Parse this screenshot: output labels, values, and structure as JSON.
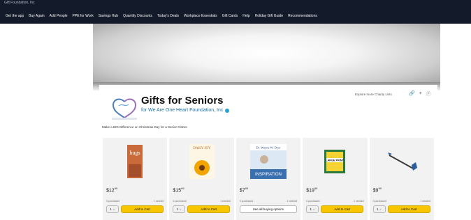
{
  "topbar": {
    "crumb": "Gift Foundation, Inc",
    "nav": [
      "Get the app",
      "Buy Again",
      "Add People",
      "PPE for Work",
      "Savings Hub",
      "Quantity Discounts",
      "Today's Deals",
      "Workplace Essentials",
      "Gift Cards",
      "Help",
      "Holiday Gift Guide",
      "Recommendations"
    ]
  },
  "list": {
    "title": "Gifts for Seniors",
    "subtitle": "for We Are One Heart Foundation, Inc",
    "explore": "Explore more Charity Lists",
    "description": "Make a BIG Difference on Christmas Day for a Senior Citizen"
  },
  "icons": {
    "link": "link-icon",
    "twitter": "twitter-icon",
    "pinterest": "pinterest-icon"
  },
  "products": [
    {
      "name": "hugs",
      "price_whole": "12",
      "price_frac": "99",
      "purchased": "0 purchased",
      "needed": "1 needed",
      "qty": "1",
      "action": "Add to Cart"
    },
    {
      "name": "Daily Joy",
      "price_whole": "15",
      "price_frac": "99",
      "purchased": "0 purchased",
      "needed": "1 needed",
      "qty": "1",
      "action": "Add to Cart"
    },
    {
      "name": "Inspiration",
      "price_whole": "7",
      "price_frac": "99",
      "purchased": "0 purchased",
      "needed": "1 needed",
      "qty": "",
      "action": "See all buying options"
    },
    {
      "name": "Large Print Cards",
      "price_whole": "19",
      "price_frac": "95",
      "purchased": "0 purchased",
      "needed": "1 needed",
      "qty": "1",
      "action": "Add to Cart"
    },
    {
      "name": "Reacher Grabber",
      "price_whole": "9",
      "price_frac": "99",
      "purchased": "0 purchased",
      "needed": "1 needed",
      "qty": "1",
      "action": "Add to Cart"
    }
  ],
  "book_covers": {
    "hugs": "hugs",
    "daily_joy": "DAILY JOY",
    "inspiration_author": "Dr. Wayne W. Dyer",
    "inspiration_title": "INSPIRATION",
    "cards": "LARGE PRINT"
  },
  "colors": {
    "topbar": "#131a2a",
    "button": "#f7c600",
    "link": "#1a6fa6"
  }
}
